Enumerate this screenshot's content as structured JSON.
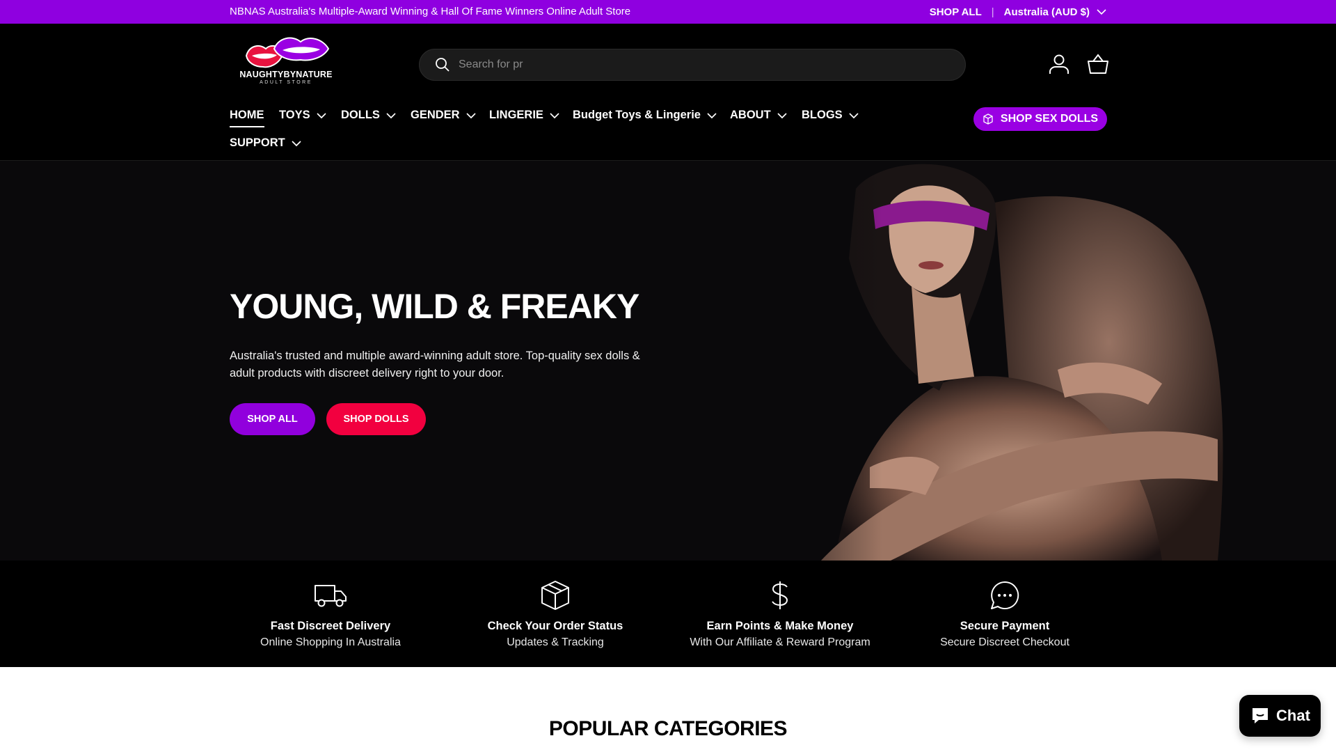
{
  "announcement": {
    "message": "NBNAS Australia's Multiple-Award Winning & Hall Of Fame Winners Online Adult Store",
    "shop_all": "SHOP ALL",
    "separator": "|",
    "country": "Australia (AUD $)"
  },
  "header": {
    "logo_text": "NAUGHTYBYNATURE",
    "logo_sub": "ADULT STORE",
    "search_placeholder": "Search for pr",
    "account_icon": "user-icon",
    "cart_icon": "basket-icon"
  },
  "nav": {
    "items": [
      {
        "label": "HOME",
        "dropdown": false
      },
      {
        "label": "TOYS",
        "dropdown": true
      },
      {
        "label": "DOLLS",
        "dropdown": true
      },
      {
        "label": "GENDER",
        "dropdown": true
      },
      {
        "label": "LINGERIE",
        "dropdown": true
      },
      {
        "label": "Budget Toys & Lingerie",
        "dropdown": true
      },
      {
        "label": "ABOUT",
        "dropdown": true
      },
      {
        "label": "BLOGS",
        "dropdown": true
      },
      {
        "label": "SUPPORT",
        "dropdown": true
      }
    ],
    "cta_label": "SHOP SEX DOLLS"
  },
  "hero": {
    "title": "YOUNG, WILD & FREAKY",
    "text": "Australia's trusted and multiple award-winning adult store. Top-quality sex dolls & adult products with discreet delivery right to your door.",
    "btn_all": "SHOP ALL",
    "btn_dolls": "SHOP DOLLS"
  },
  "features": [
    {
      "icon": "truck-icon",
      "title": "Fast Discreet Delivery",
      "sub": "Online Shopping In Australia"
    },
    {
      "icon": "box-icon",
      "title": "Check Your Order Status",
      "sub": "Updates & Tracking"
    },
    {
      "icon": "dollar-icon",
      "title": "Earn Points & Make Money",
      "sub": "With Our Affiliate & Reward Program"
    },
    {
      "icon": "chat-bubble-icon",
      "title": "Secure Payment",
      "sub": "Secure Discreet Checkout"
    }
  ],
  "popular_title": "POPULAR CATEGORIES",
  "chat_label": "Chat",
  "colors": {
    "brand_purple": "#9100dd",
    "brand_red": "#f2003f",
    "header_bg": "#000000"
  }
}
